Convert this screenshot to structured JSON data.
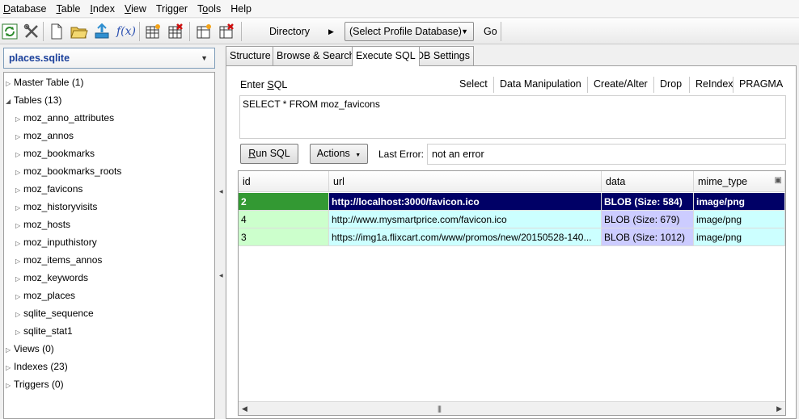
{
  "menu": [
    {
      "label": "Database",
      "mn": "D"
    },
    {
      "label": "Table",
      "mn": "T"
    },
    {
      "label": "Index",
      "mn": "I"
    },
    {
      "label": "View",
      "mn": "V"
    },
    {
      "label": "Trigger",
      "mn": ""
    },
    {
      "label": "Tools",
      "mn": "o"
    },
    {
      "label": "Help",
      "mn": ""
    }
  ],
  "toolbar": {
    "directory_label": "Directory",
    "profile_db": "(Select Profile Database)",
    "go_label": "Go",
    "icons": [
      "reload-icon",
      "tools-icon",
      "new-file-icon",
      "open-folder-icon",
      "connect-icon",
      "function-icon",
      "create-table-icon",
      "drop-table-icon",
      "create-index-icon",
      "drop-index-icon"
    ],
    "function_text": "f(x)"
  },
  "left": {
    "db_name": "places.sqlite",
    "tree": [
      {
        "label": "Master Table (1)",
        "level": 0,
        "expander": "▷"
      },
      {
        "label": "Tables (13)",
        "level": 0,
        "expander": "◢"
      },
      {
        "label": "moz_anno_attributes",
        "level": 1,
        "expander": "▷"
      },
      {
        "label": "moz_annos",
        "level": 1,
        "expander": "▷"
      },
      {
        "label": "moz_bookmarks",
        "level": 1,
        "expander": "▷"
      },
      {
        "label": "moz_bookmarks_roots",
        "level": 1,
        "expander": "▷"
      },
      {
        "label": "moz_favicons",
        "level": 1,
        "expander": "▷"
      },
      {
        "label": "moz_historyvisits",
        "level": 1,
        "expander": "▷"
      },
      {
        "label": "moz_hosts",
        "level": 1,
        "expander": "▷"
      },
      {
        "label": "moz_inputhistory",
        "level": 1,
        "expander": "▷"
      },
      {
        "label": "moz_items_annos",
        "level": 1,
        "expander": "▷"
      },
      {
        "label": "moz_keywords",
        "level": 1,
        "expander": "▷"
      },
      {
        "label": "moz_places",
        "level": 1,
        "expander": "▷"
      },
      {
        "label": "sqlite_sequence",
        "level": 1,
        "expander": "▷"
      },
      {
        "label": "sqlite_stat1",
        "level": 1,
        "expander": "▷"
      },
      {
        "label": "Views (0)",
        "level": 0,
        "expander": "▷"
      },
      {
        "label": "Indexes (23)",
        "level": 0,
        "expander": "▷"
      },
      {
        "label": "Triggers (0)",
        "level": 0,
        "expander": "▷"
      }
    ]
  },
  "tabs": [
    {
      "label": "Structure",
      "active": false
    },
    {
      "label": "Browse & Search",
      "active": false
    },
    {
      "label": "Execute SQL",
      "active": true
    },
    {
      "label": "DB Settings",
      "active": false
    }
  ],
  "sql": {
    "enter_label": "Enter SQL",
    "quick": [
      "Select",
      "Data Manipulation",
      "Create/Alter",
      "Drop",
      "ReIndex",
      "PRAGMA"
    ],
    "query": "SELECT * FROM moz_favicons",
    "run_label": "Run SQL",
    "actions_label": "Actions",
    "last_error_label": "Last Error:",
    "last_error_value": "not an error"
  },
  "grid": {
    "columns": [
      "id",
      "url",
      "data",
      "mime_type"
    ],
    "rows": [
      [
        "2",
        "http://localhost:3000/favicon.ico",
        "BLOB (Size: 584)",
        "image/png"
      ],
      [
        "4",
        "http://www.mysmartprice.com/favicon.ico",
        "BLOB (Size: 679)",
        "image/png"
      ],
      [
        "3",
        "https://img1a.flixcart.com/www/promos/new/20150528-140...",
        "BLOB (Size: 1012)",
        "image/png"
      ]
    ],
    "selected_row": 0
  },
  "colors": {
    "selected_row_bg": "#000066",
    "selected_id_bg": "#339933",
    "id_col_bg": "#ccffcc",
    "text_col_bg": "#ccffff",
    "blob_col_bg": "#ccccff"
  }
}
